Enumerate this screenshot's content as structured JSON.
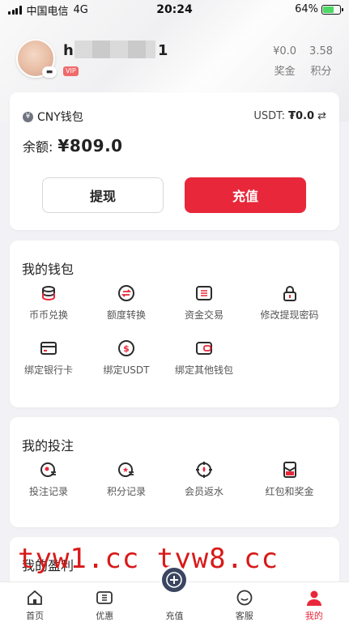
{
  "status_bar": {
    "carrier": "中国电信",
    "network": "4G",
    "time": "20:24",
    "battery": "64%",
    "battery_level": 0.64
  },
  "profile": {
    "username_start": "h",
    "username_end": "1",
    "vip": "VIP",
    "stats": [
      {
        "value": "¥0.0",
        "label": "奖金"
      },
      {
        "value": "3.58",
        "label": "积分"
      }
    ]
  },
  "wallet": {
    "title": "CNY钱包",
    "cny_icon": "¥",
    "usdt_label": "USDT:",
    "usdt_value": "₮0.0",
    "balance_label": "余额:",
    "balance_amount": "¥809.0",
    "withdraw": "提现",
    "deposit": "充值"
  },
  "my_wallet": {
    "title": "我的钱包",
    "items": [
      {
        "label": "币币兑换",
        "icon": "coins-icon"
      },
      {
        "label": "额度转换",
        "icon": "transfer-icon"
      },
      {
        "label": "资金交易",
        "icon": "list-icon"
      },
      {
        "label": "修改提现密码",
        "icon": "lock-icon"
      },
      {
        "label": "绑定银行卡",
        "icon": "card-icon"
      },
      {
        "label": "绑定USDT",
        "icon": "dollar-icon"
      },
      {
        "label": "绑定其他钱包",
        "icon": "wallet-icon"
      }
    ]
  },
  "my_bets": {
    "title": "我的投注",
    "items": [
      {
        "label": "投注记录",
        "icon": "bet-record-icon"
      },
      {
        "label": "积分记录",
        "icon": "points-record-icon"
      },
      {
        "label": "会员返水",
        "icon": "rebate-icon"
      },
      {
        "label": "红包和奖金",
        "icon": "red-packet-icon"
      }
    ]
  },
  "my_profit": {
    "title": "我的盈利"
  },
  "tabs": [
    {
      "label": "首页",
      "icon": "home-icon"
    },
    {
      "label": "优惠",
      "icon": "coupon-icon"
    },
    {
      "label": "充值",
      "icon": "deposit-icon"
    },
    {
      "label": "客服",
      "icon": "support-icon"
    },
    {
      "label": "我的",
      "icon": "profile-icon"
    }
  ],
  "watermark": "tyw1.cc  tyw8.cc",
  "colors": {
    "accent": "#e8283a",
    "icon_dark": "#2b2b2b"
  }
}
